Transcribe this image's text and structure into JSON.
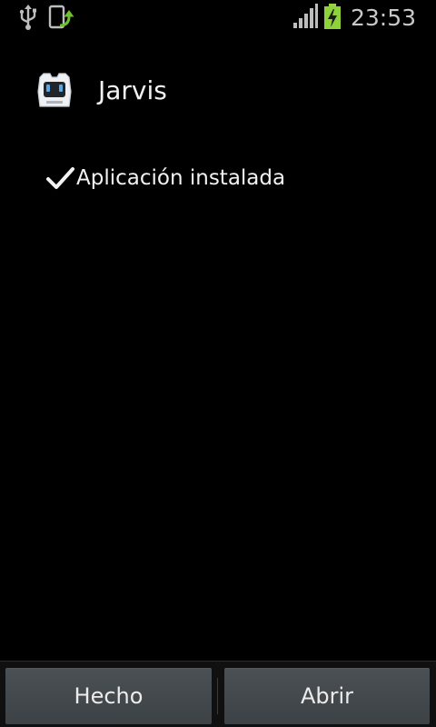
{
  "status_bar": {
    "time": "23:53",
    "icons": [
      "usb-icon",
      "screen-upload-icon",
      "signal-icon",
      "battery-charging-icon"
    ],
    "colors": {
      "charging": "#8fd13b",
      "upload_arrow": "#6fbf2f"
    }
  },
  "app": {
    "name": "Jarvis",
    "icon": "app-robot-icon"
  },
  "install": {
    "status_icon": "check-icon",
    "message": "Aplicación instalada"
  },
  "buttons": {
    "done_label": "Hecho",
    "open_label": "Abrir"
  }
}
